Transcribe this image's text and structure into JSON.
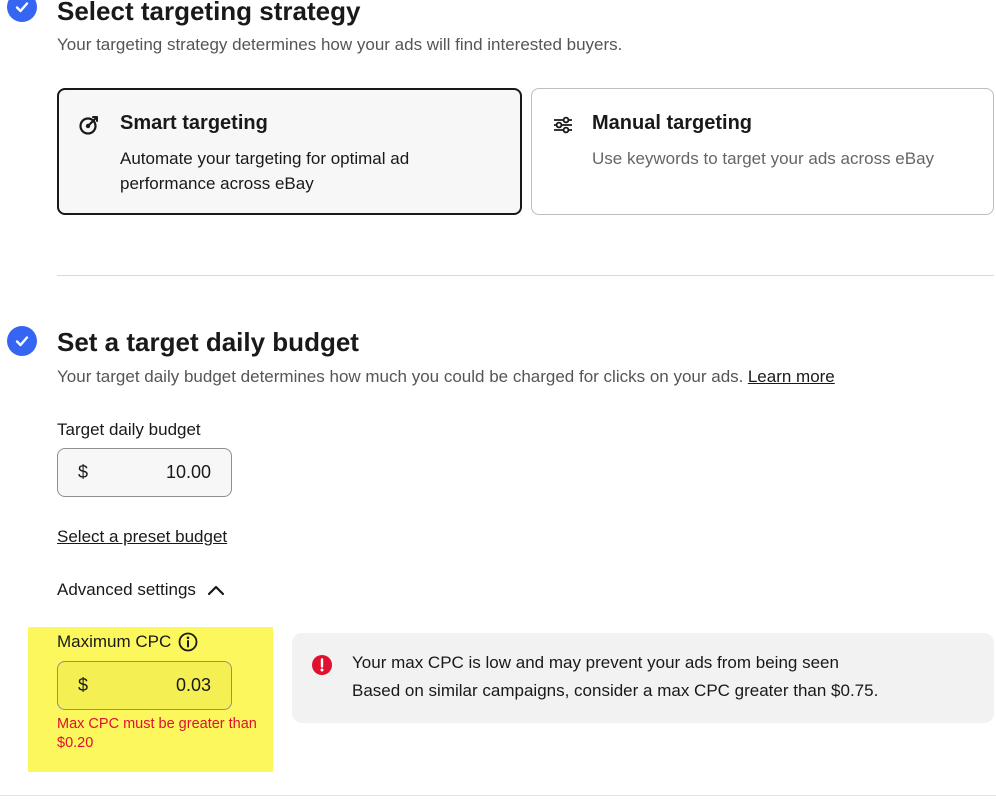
{
  "targeting": {
    "title": "Select targeting strategy",
    "subtitle": "Your targeting strategy determines how your ads will find interested buyers.",
    "options": [
      {
        "icon": "target-icon",
        "title": "Smart targeting",
        "description": "Automate your targeting for optimal ad performance across eBay",
        "selected": true
      },
      {
        "icon": "sliders-icon",
        "title": "Manual targeting",
        "description": "Use keywords to target your ads across eBay",
        "selected": false
      }
    ]
  },
  "budget": {
    "title": "Set a target daily budget",
    "subtitle": "Your target daily budget determines how much you could be charged for clicks on your ads.",
    "learn_more": "Learn more",
    "field_label": "Target daily budget",
    "currency": "$",
    "value": "10.00",
    "preset_link": "Select a preset budget",
    "advanced_label": "Advanced settings"
  },
  "max_cpc": {
    "label": "Maximum CPC",
    "currency": "$",
    "value": "0.03",
    "error": "Max CPC must be greater than $0.20",
    "highlight_color": "#fbf75c"
  },
  "alert": {
    "title": "Your max CPC is low and may prevent your ads from being seen",
    "message": "Based on similar campaigns, consider a max CPC greater than $0.75."
  },
  "colors": {
    "accent": "#3665f3",
    "error": "#e0102f"
  }
}
